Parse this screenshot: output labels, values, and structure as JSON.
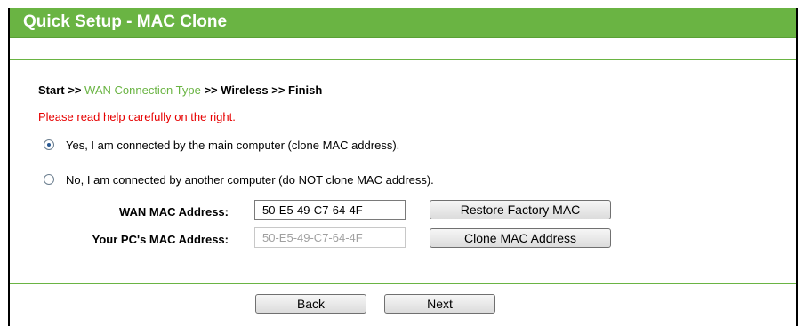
{
  "header": {
    "title": "Quick Setup - MAC Clone"
  },
  "breadcrumb": {
    "start": "Start >>",
    "wan_connection_type": "WAN Connection Type",
    "rest": ">> Wireless >> Finish"
  },
  "help_note": "Please read help carefully on the right.",
  "radio_options": [
    {
      "label": "Yes, I am connected by the main computer (clone MAC address).",
      "checked": true
    },
    {
      "label": "No, I am connected by another computer (do NOT clone MAC address).",
      "checked": false
    }
  ],
  "wan_mac": {
    "label": "WAN MAC Address:",
    "value": "50-E5-49-C7-64-4F",
    "button_label": "Restore Factory MAC"
  },
  "pc_mac": {
    "label": "Your PC's MAC Address:",
    "value": "50-E5-49-C7-64-4F",
    "button_label": "Clone MAC Address"
  },
  "nav": {
    "back_label": "Back",
    "next_label": "Next"
  },
  "colors": {
    "header_green": "#6ab443",
    "link_green": "#6ab443",
    "note_red": "#e60000"
  }
}
